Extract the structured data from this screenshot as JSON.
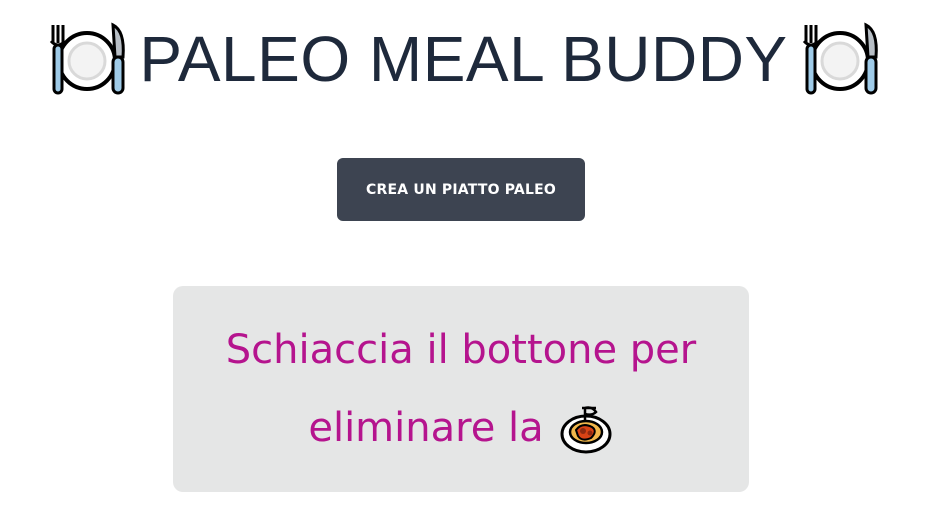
{
  "header": {
    "title": "PALEO MEAL BUDDY",
    "left_icon": "fork-knife-plate-icon",
    "right_icon": "fork-knife-plate-icon"
  },
  "actions": {
    "generate_button_label": "CREA UN PIATTO PALEO"
  },
  "message": {
    "line1": "Schiaccia il bottone per",
    "line2": "eliminare la",
    "line2_icon": "spaghetti-icon"
  },
  "colors": {
    "title": "#1e293b",
    "button_bg": "#3d4451",
    "button_text": "#ffffff",
    "message_bg": "#e5e6e6",
    "message_text": "#b5148e"
  }
}
